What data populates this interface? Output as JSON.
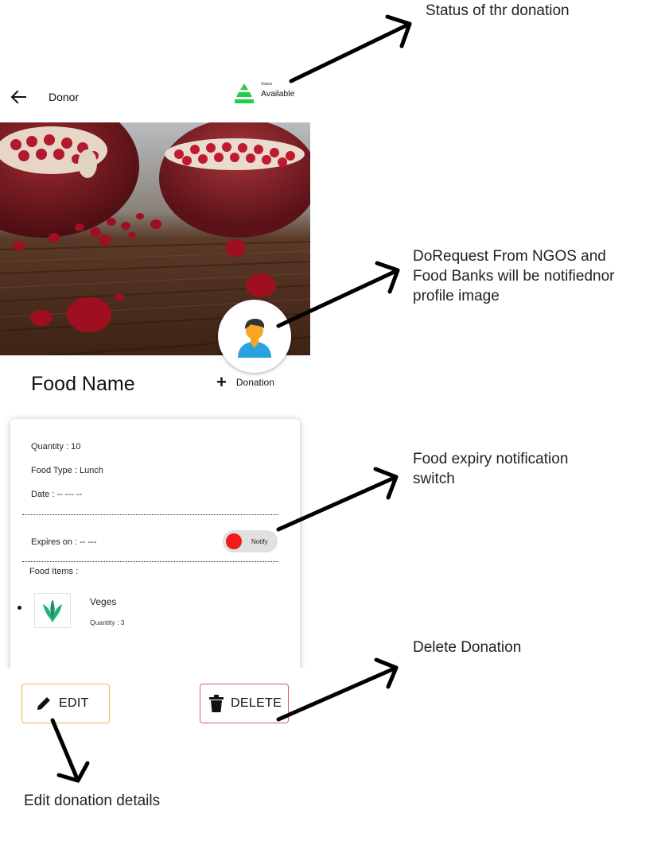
{
  "header": {
    "title": "Donor",
    "status_caption": "Status",
    "status_value": "Available",
    "status_color": "#1fcf4c"
  },
  "donation": {
    "food_name": "Food Name",
    "add_label": "Donation",
    "quantity": "Quantity : 10",
    "food_type": "Food Type : Lunch",
    "date": "Date : -- --- --",
    "expires": "Expires on : -- ---",
    "notify_label": "Notify",
    "notify_on": false,
    "food_items_label": "Food Items :",
    "items": [
      {
        "name": "Veges",
        "quantity": "Quantity : 3"
      }
    ]
  },
  "actions": {
    "edit_label": "EDIT",
    "delete_label": "DELETE",
    "edit_border_color": "#e8b94a",
    "delete_border_color": "#e05a5f"
  },
  "annotations": {
    "status": "Status of thr donation",
    "request": [
      "DoRequest From NGOS and",
      "Food Banks will be notifiednor",
      "profile image"
    ],
    "expiry": [
      "Food expiry notification",
      "switch"
    ],
    "delete": "Delete Donation",
    "edit": "Edit donation details"
  },
  "icons": {
    "back": "arrow-left-icon",
    "status": "triangle-status-icon",
    "avatar": "user-avatar-icon",
    "add": "plus-icon",
    "item": "leaf-icon",
    "edit": "pencil-icon",
    "delete": "trash-icon"
  }
}
